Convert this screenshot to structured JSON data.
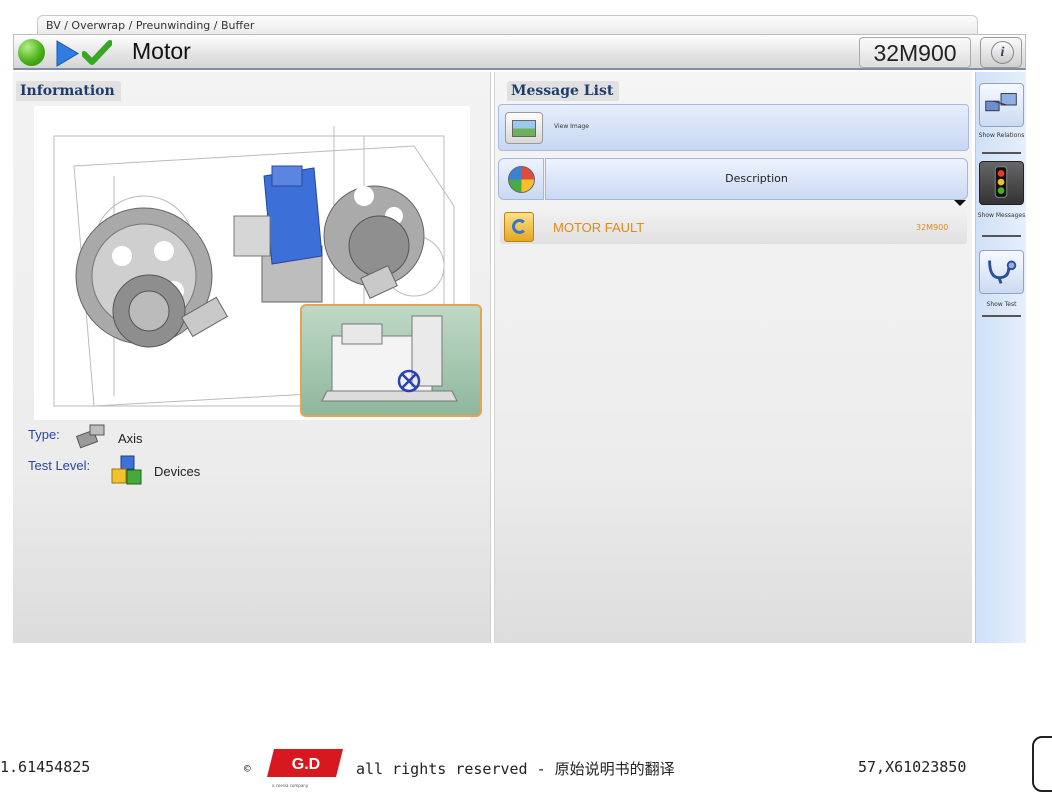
{
  "header": {
    "breadcrumb": "BV / Overwrap / Preunwinding / Buffer",
    "title": "Motor",
    "code": "32M900",
    "info_icon_glyph": "i",
    "status_colors": {
      "ok": "#49b21a",
      "play": "#2f7de0",
      "check": "#3aa625"
    }
  },
  "information": {
    "title": "Information",
    "type_label": "Type:",
    "type_value": "Axis",
    "test_level_label": "Test Level:",
    "test_level_value": "Devices"
  },
  "message_list": {
    "title": "Message List",
    "view_image_label": "View Image",
    "description_header": "Description",
    "messages": [
      {
        "text": "MOTOR FAULT",
        "code": "32M900",
        "color": "#e08a18"
      }
    ]
  },
  "sidebar": {
    "show_relations": "Show Relations",
    "show_messages": "Show Messages",
    "show_test": "Show Test"
  },
  "footer": {
    "left_ref": "1.61454825",
    "copyright_symbol": "©",
    "logo_text": "G.D",
    "logo_sub": "a coesia company",
    "rights": "all rights reserved - 原始说明书的翻译",
    "right_ref": "57,X61023850"
  }
}
